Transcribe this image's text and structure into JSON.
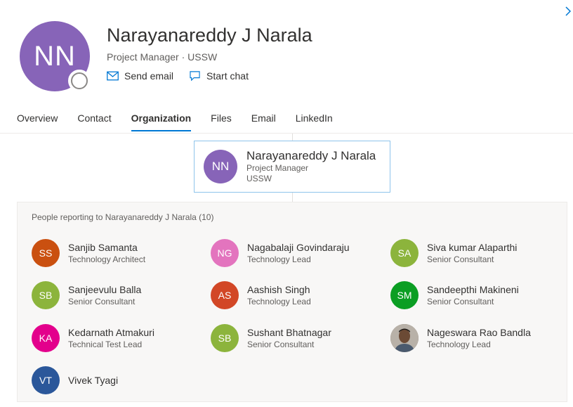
{
  "profile": {
    "initials": "NN",
    "name": "Narayanareddy J Narala",
    "subtitle": "Project Manager · USSW",
    "avatar_color": "#8764b8",
    "actions": [
      {
        "label": "Send email",
        "icon": "mail-icon"
      },
      {
        "label": "Start chat",
        "icon": "chat-icon"
      }
    ]
  },
  "tabs": [
    {
      "label": "Overview"
    },
    {
      "label": "Contact"
    },
    {
      "label": "Organization",
      "active": true
    },
    {
      "label": "Files"
    },
    {
      "label": "Email"
    },
    {
      "label": "LinkedIn"
    }
  ],
  "manager_card": {
    "initials": "NN",
    "name": "Narayanareddy J Narala",
    "title": "Project Manager",
    "department": "USSW"
  },
  "reports": {
    "heading": "People reporting to Narayanareddy J Narala (10)",
    "people": [
      {
        "initials": "SS",
        "name": "Sanjib Samanta",
        "title": "Technology Architect",
        "color": "#ca5010"
      },
      {
        "initials": "NG",
        "name": "Nagabalaji Govindaraju",
        "title": "Technology Lead",
        "color": "#e374be"
      },
      {
        "initials": "SA",
        "name": "Siva kumar Alaparthi",
        "title": "Senior Consultant",
        "color": "#8cb43c"
      },
      {
        "initials": "SB",
        "name": "Sanjeevulu Balla",
        "title": "Senior Consultant",
        "color": "#8cb43c"
      },
      {
        "initials": "AS",
        "name": "Aashish Singh",
        "title": "Technology Lead",
        "color": "#d24726"
      },
      {
        "initials": "SM",
        "name": "Sandeepthi Makineni",
        "title": "Senior Consultant",
        "color": "#0b9e23"
      },
      {
        "initials": "KA",
        "name": "Kedarnath Atmakuri",
        "title": "Technical Test Lead",
        "color": "#e3008c"
      },
      {
        "initials": "SB",
        "name": "Sushant Bhatnagar",
        "title": "Senior Consultant",
        "color": "#8cb43c"
      },
      {
        "initials": "",
        "name": "Nageswara Rao Bandla",
        "title": "Technology Lead",
        "color": "#7a6a5a",
        "photo": true
      },
      {
        "initials": "VT",
        "name": "Vivek Tyagi",
        "title": "",
        "color": "#2b579a"
      }
    ]
  }
}
